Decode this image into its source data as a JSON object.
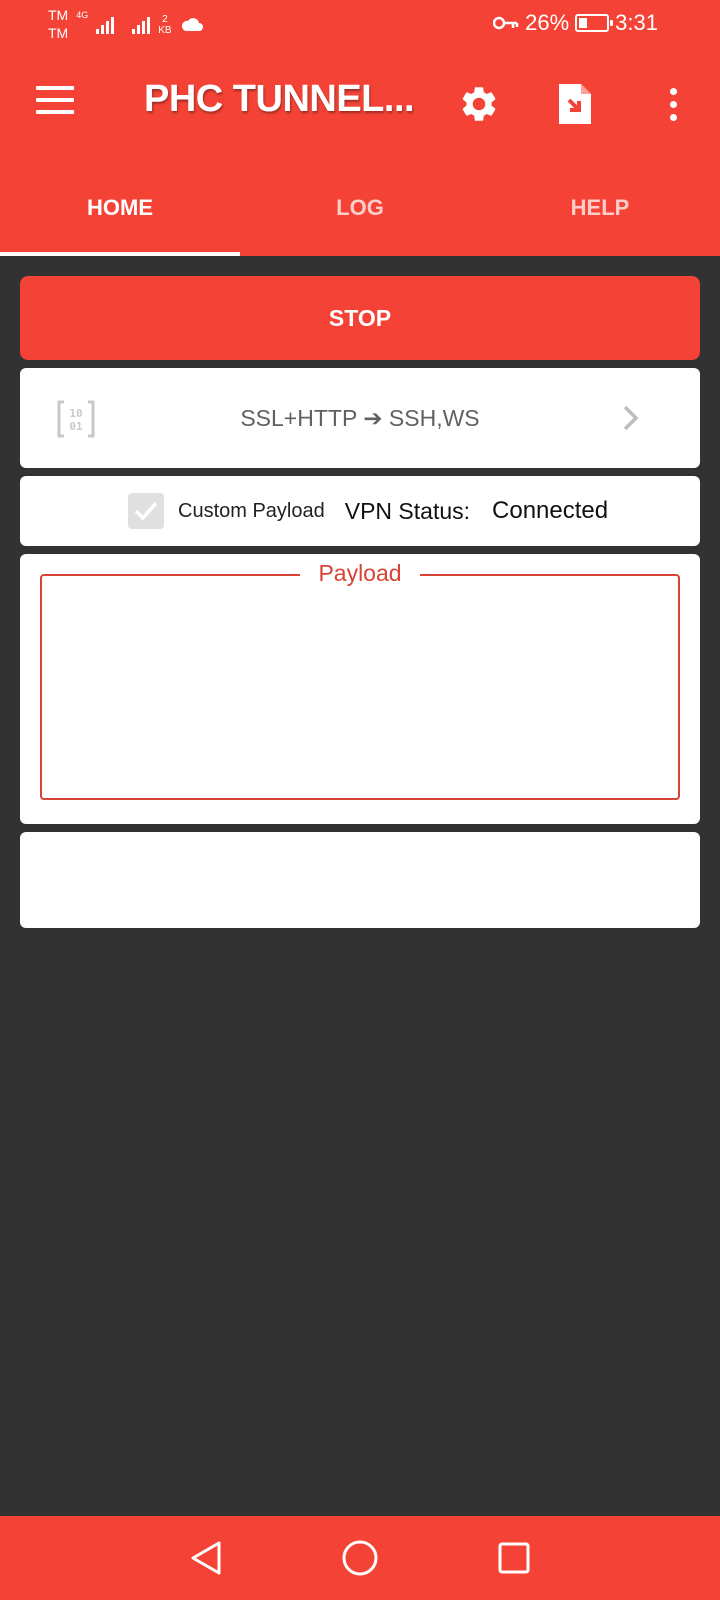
{
  "status_bar": {
    "carrier_top": "TM",
    "carrier_bottom": "TM",
    "network": "4G",
    "speed_value": "2",
    "speed_unit": "KB",
    "battery": "26%",
    "time": "3:31",
    "icons": [
      "signal-icon",
      "cloud-icon",
      "vpn-key-icon",
      "battery-icon"
    ]
  },
  "appbar": {
    "title": "PHC TUNNEL...",
    "icons": [
      "menu-icon",
      "settings-icon",
      "import-file-icon",
      "overflow-icon"
    ]
  },
  "tabs": [
    {
      "label": "HOME",
      "active": true
    },
    {
      "label": "LOG",
      "active": false
    },
    {
      "label": "HELP",
      "active": false
    }
  ],
  "main": {
    "stop_label": "STOP",
    "mode_text": "SSL+HTTP ➔ SSH,WS",
    "custom_payload_label": "Custom Payload",
    "custom_payload_checked": true,
    "vpn_status_label": "VPN Status:",
    "vpn_status_value": "Connected",
    "payload_label": "Payload",
    "payload_value": ""
  },
  "colors": {
    "primary": "#f44336",
    "background": "#323232",
    "payload_accent": "#d84335"
  }
}
